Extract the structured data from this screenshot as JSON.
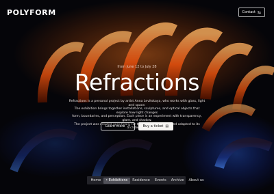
{
  "brand": {
    "logo": "POLYFORM"
  },
  "header": {
    "contact_label": "Contact",
    "contact_icon": "arrows-swap-icon"
  },
  "hero": {
    "dates": "from June 12 to July 28",
    "title": "Refractions",
    "description": [
      "Refractions is a personal project by artist Anna Levitskaya, who works with glass, light and space.",
      "The exhibition brings together installations, sculptures, and optical objects that explore how light changes",
      "form, boundaries, and perception. Each piece is an experiment with transparency, glare, and shadow.",
      "The project was created specifically for the POLYFORM space and adapted to its architecture."
    ],
    "learn_more_label": "Learn more",
    "learn_more_icon": "external-link-icon",
    "ticket_label": "Buy a ticket",
    "ticket_icon": "ticket-icon"
  },
  "nav": {
    "items": [
      {
        "label": "Home",
        "active": false
      },
      {
        "label": "• Exhibitions",
        "active": true
      },
      {
        "label": "Residence",
        "active": false
      },
      {
        "label": "Events",
        "active": false
      },
      {
        "label": "Archive",
        "active": false
      },
      {
        "label": "About us",
        "active": false
      }
    ]
  },
  "colors": {
    "accent_orange": "#ff6a1a",
    "accent_blue": "#2e6bff",
    "background": "#07070c"
  }
}
